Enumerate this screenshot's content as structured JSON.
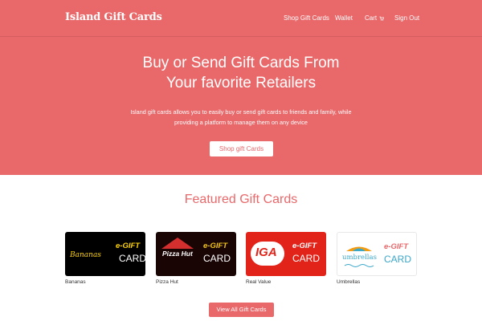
{
  "navbar": {
    "brand": "Island Gift Cards",
    "links": [
      "Shop Gift Cards",
      "Wallet",
      "Cart",
      "Sign Out"
    ]
  },
  "hero": {
    "title_line1": "Buy or Send Gift Cards From",
    "title_line2": "Your favorite Retailers",
    "subtitle_line1": "Island gift cards allows you to easily buy or send gift cards to friends and family, while",
    "subtitle_line2": "providing a platform to manage them on any device",
    "cta_label": "Shop gift Cards"
  },
  "featured": {
    "title": "Featured Gift Cards",
    "cards": [
      {
        "name": "Bananas",
        "logo": "Bananas",
        "egift": "e-GIFT",
        "card": "CARD"
      },
      {
        "name": "Pizza Hut",
        "logo": "Pizza Hut",
        "egift": "e-GIFT",
        "card": "CARD"
      },
      {
        "name": "Real Value",
        "logo": "IGA",
        "egift": "e-GIFT",
        "card": "CARD"
      },
      {
        "name": "Umbrellas",
        "logo": "umbrellas",
        "egift": "e-GIFT",
        "card": "CARD"
      }
    ],
    "view_all_label": "View All Gift Cards"
  },
  "colors": {
    "brand_red": "#e9686a",
    "card_black": "#000000",
    "card_iga_red": "#e2231a",
    "card_white": "#ffffff"
  },
  "icons": [
    "cart-icon"
  ]
}
